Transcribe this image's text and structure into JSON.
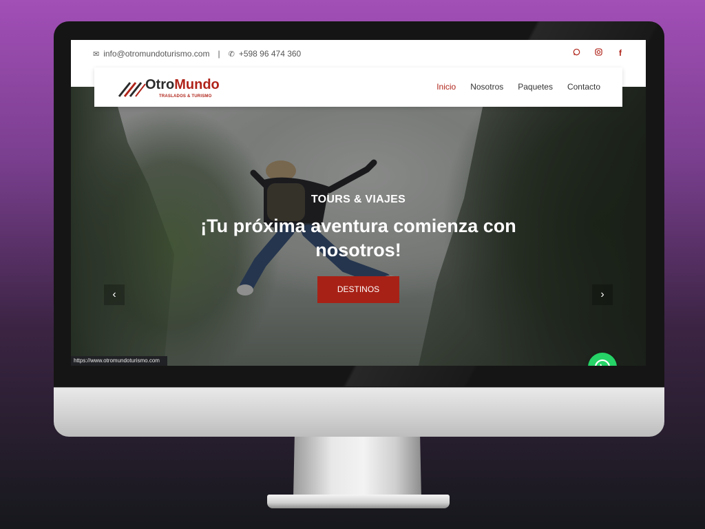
{
  "topbar": {
    "email": "info@otromundoturismo.com",
    "separator": "|",
    "phone": "+598 96 474 360",
    "social": [
      {
        "icon": "whatsapp-icon"
      },
      {
        "icon": "instagram-icon"
      },
      {
        "icon": "facebook-icon",
        "glyph": "f"
      }
    ]
  },
  "logo": {
    "name_part1": "Otro",
    "name_part2": "Mundo",
    "tagline": "TRASLADOS & TURISMO"
  },
  "nav": {
    "items": [
      "Inicio",
      "Nosotros",
      "Paquetes",
      "Contacto"
    ],
    "active": "Inicio"
  },
  "hero": {
    "subtitle": "TOURS & VIAJES",
    "title": "¡Tu próxima aventura comienza con nosotros!",
    "button": "DESTINOS",
    "prev_arrow": "‹",
    "next_arrow": "›"
  },
  "status_bar": {
    "url": "https://www.otromundoturismo.com"
  },
  "colors": {
    "accent": "#b0241a",
    "button": "#a82116",
    "whatsapp": "#25d366",
    "background_top": "#a24fb6",
    "background_bottom": "#16181c"
  }
}
